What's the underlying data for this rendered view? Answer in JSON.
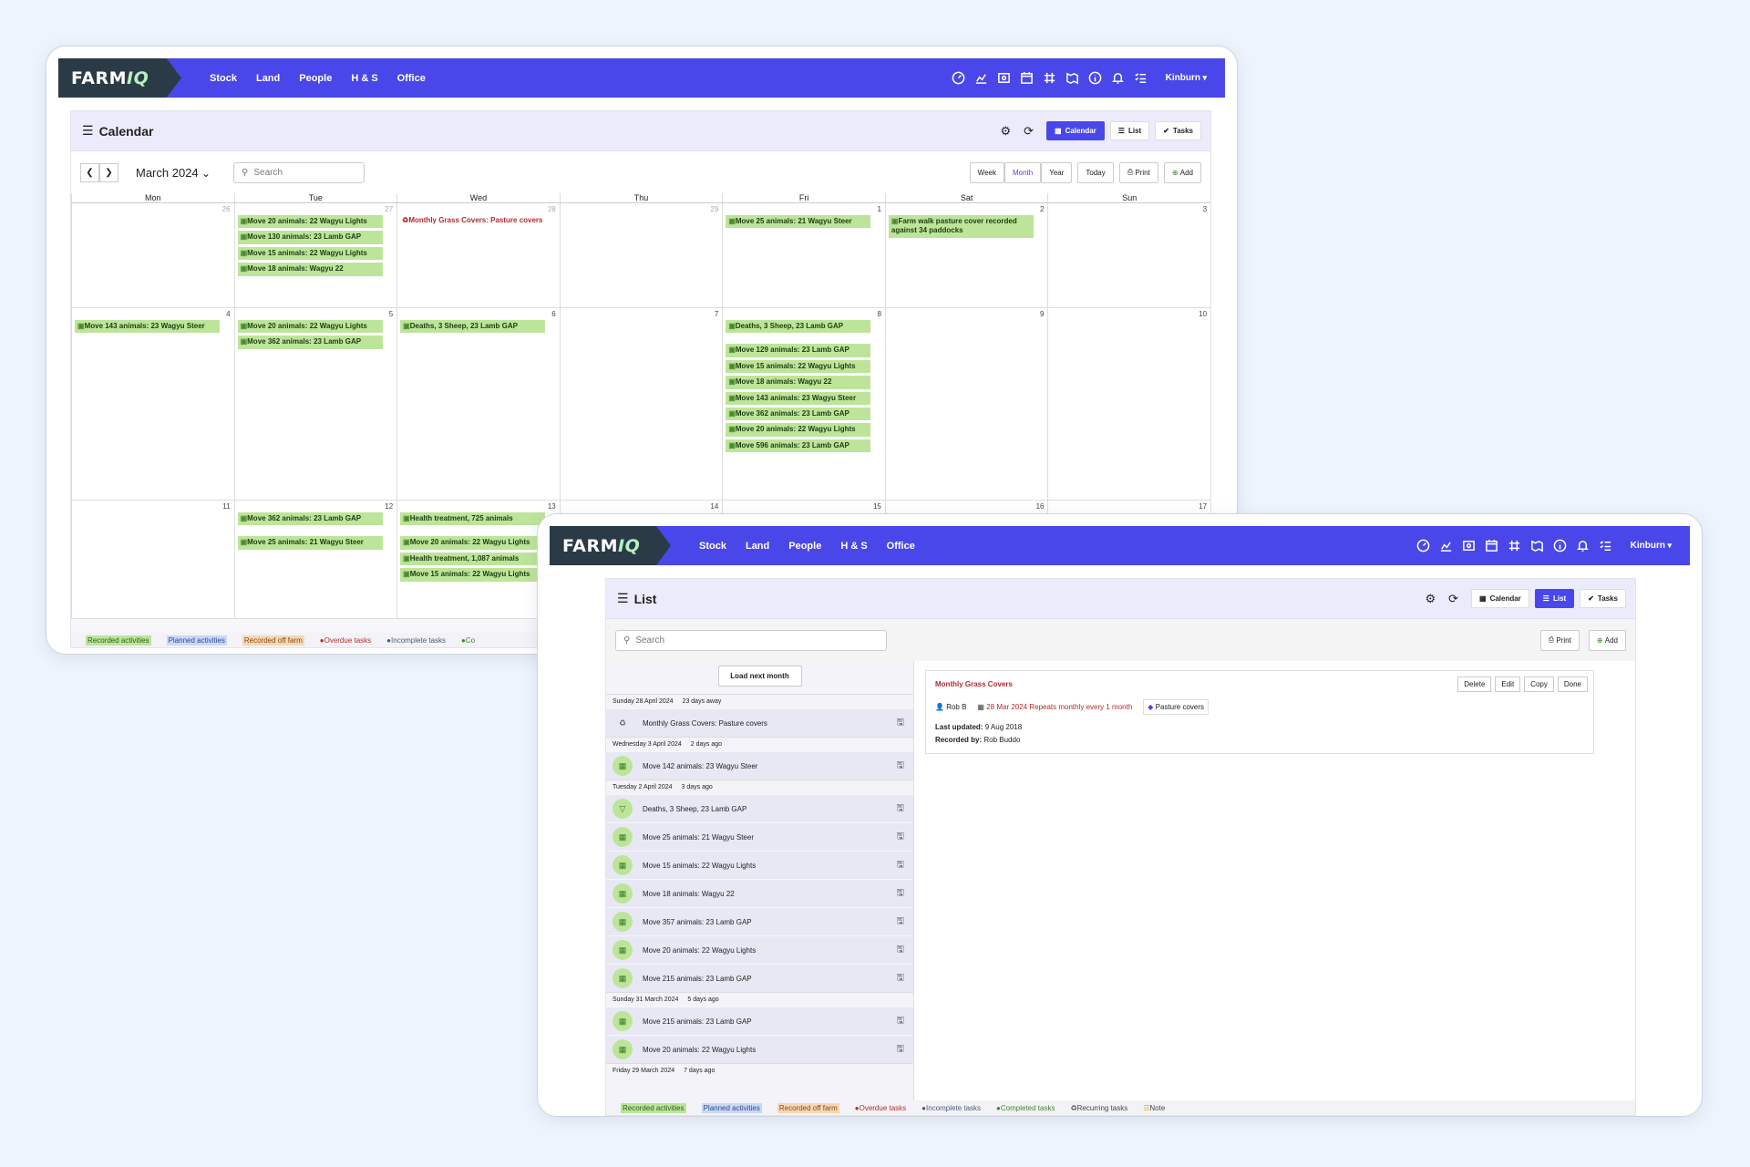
{
  "brand": {
    "logo_main": "FARM",
    "logo_accent": "IQ"
  },
  "nav": {
    "items": [
      "Stock",
      "Land",
      "People",
      "H & S",
      "Office"
    ],
    "user": "Kinburn"
  },
  "calendar_view": {
    "title": "Calendar",
    "view_tabs": [
      "Calendar",
      "List",
      "Tasks"
    ],
    "month_label": "March 2024",
    "search_placeholder": "Search",
    "range_buttons": [
      "Week",
      "Month",
      "Year"
    ],
    "today": "Today",
    "print": "Print",
    "add": "Add",
    "weekdays": [
      "Mon",
      "Tue",
      "Wed",
      "Thu",
      "Fri",
      "Sat",
      "Sun"
    ],
    "week1": {
      "days": [
        "26",
        "27",
        "28",
        "29",
        "1",
        "2",
        "3"
      ],
      "tue": [
        "Move 20 animals: 22 Wagyu Lights",
        "Move 130 animals: 23 Lamb GAP",
        "Move 15 animals: 22 Wagyu Lights",
        "Move 18 animals: Wagyu 22"
      ],
      "wed_task": "Monthly Grass Covers: Pasture covers",
      "fri": [
        "Move 25 animals: 21 Wagyu Steer"
      ],
      "sat": [
        "Farm walk pasture cover recorded against 34 paddocks"
      ]
    },
    "week2": {
      "days": [
        "4",
        "5",
        "6",
        "7",
        "8",
        "9",
        "10"
      ],
      "mon": [
        "Move 143 animals: 23 Wagyu Steer"
      ],
      "tue": [
        "Move 20 animals: 22 Wagyu Lights",
        "Move 362 animals: 23 Lamb GAP"
      ],
      "wed": [
        "Deaths, 3 Sheep, 23 Lamb GAP"
      ],
      "fri": [
        "Deaths, 3 Sheep, 23 Lamb GAP",
        "Move 129 animals: 23 Lamb GAP",
        "Move 15 animals: 22 Wagyu Lights",
        "Move 18 animals: Wagyu 22",
        "Move 143 animals: 23 Wagyu Steer",
        "Move 362 animals: 23 Lamb GAP",
        "Move 20 animals: 22 Wagyu Lights",
        "Move 596 animals: 23 Lamb GAP"
      ]
    },
    "week3": {
      "days": [
        "11",
        "12",
        "13",
        "14",
        "15",
        "16",
        "17"
      ],
      "tue": [
        "Move 362 animals: 23 Lamb GAP",
        "Move 25 animals: 21 Wagyu Steer"
      ],
      "wed": [
        "Health treatment, 725 animals",
        "Move 20 animals: 22 Wagyu Lights",
        "Health treatment, 1,087 animals",
        "Move 15 animals: 22 Wagyu Lights"
      ]
    }
  },
  "legend": [
    "Recorded activities",
    "Planned activities",
    "Recorded off farm",
    "Overdue tasks",
    "Incomplete tasks",
    "Completed tasks",
    "Recurring tasks",
    "Note"
  ],
  "legend_short": [
    "Recorded activities",
    "Planned activities",
    "Recorded off farm",
    "Overdue tasks",
    "Incomplete tasks",
    "Co"
  ],
  "list_view": {
    "title": "List",
    "view_tabs": [
      "Calendar",
      "List",
      "Tasks"
    ],
    "search_placeholder": "Search",
    "print": "Print",
    "add": "Add",
    "load_next": "Load next month",
    "groups": [
      {
        "date": "Sunday 28 April 2024",
        "ago": "23 days away",
        "items": [
          "Monthly Grass Covers: Pasture covers"
        ]
      },
      {
        "date": "Wednesday 3 April 2024",
        "ago": "2 days ago",
        "items": [
          "Move 142 animals: 23 Wagyu Steer"
        ]
      },
      {
        "date": "Tuesday 2 April 2024",
        "ago": "3 days ago",
        "items": [
          "Deaths, 3 Sheep, 23 Lamb GAP",
          "Move 25 animals: 21 Wagyu Steer",
          "Move 15 animals: 22 Wagyu Lights",
          "Move 18 animals: Wagyu 22",
          "Move 357 animals: 23 Lamb GAP",
          "Move 20 animals: 22 Wagyu Lights",
          "Move 215 animals: 23 Lamb GAP"
        ]
      },
      {
        "date": "Sunday 31 March 2024",
        "ago": "5 days ago",
        "items": [
          "Move 215 animals: 23 Lamb GAP",
          "Move 20 animals: 22 Wagyu Lights"
        ]
      },
      {
        "date": "Friday 29 March 2024",
        "ago": "7 days ago",
        "items": []
      }
    ],
    "detail": {
      "title": "Monthly Grass Covers",
      "buttons": [
        "Delete",
        "Edit",
        "Copy",
        "Done"
      ],
      "person": "Rob B",
      "schedule": "28 Mar 2024 Repeats monthly every 1 month",
      "tag": "Pasture covers",
      "last_updated_label": "Last updated:",
      "last_updated": "9 Aug 2018",
      "recorded_by_label": "Recorded by:",
      "recorded_by": "Rob Buddo"
    }
  },
  "colors": {
    "nav": "#4a47ea",
    "logo_bg": "#2a3b47",
    "event_green": "#bde59a",
    "overdue_red": "#b52b2b"
  }
}
